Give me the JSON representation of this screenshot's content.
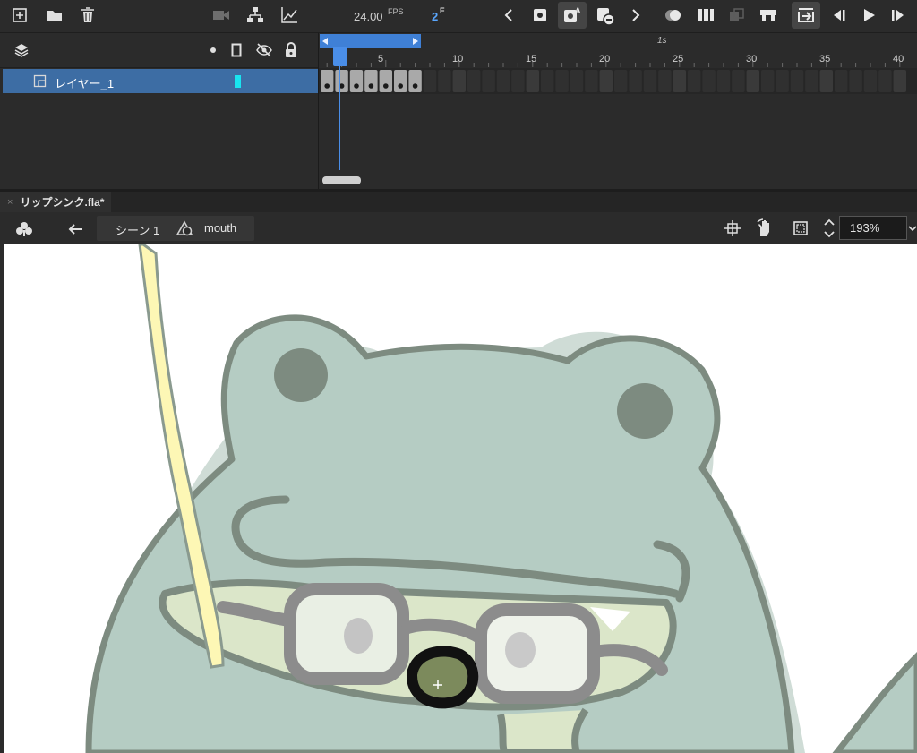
{
  "timeline": {
    "fps_value": "24.00",
    "fps_unit": "FPS",
    "current_frame": "2",
    "frame_unit": "F",
    "ruler_seconds_label": "1s",
    "tick_labels": [
      "5",
      "10",
      "15",
      "20",
      "25",
      "30",
      "35",
      "40"
    ],
    "keyframe_count": 7
  },
  "layers": [
    {
      "name": "レイヤー_1",
      "color": "#19e4f0",
      "selected": true
    }
  ],
  "document": {
    "tab_title": "リップシンク.fla*",
    "close_glyph": "×"
  },
  "editbar": {
    "scene": "シーン 1",
    "symbol": "mouth",
    "zoom": "193%"
  },
  "colors": {
    "accent": "#3f80d6",
    "layer_selected": "#3d6da4",
    "frog_body": "#b5ccc3",
    "frog_outline": "#7d8b80",
    "stage": "#ffffff"
  },
  "icons": {
    "toolbar_left": [
      "new-layer-icon",
      "new-folder-icon",
      "delete-icon"
    ],
    "toolbar_mid": [
      "camera-icon",
      "layer-parenting-icon",
      "graph-icon"
    ],
    "playback": [
      "prev-keyframe-icon",
      "insert-keyframe-icon",
      "auto-keyframe-icon",
      "clear-keyframe-icon",
      "next-keyframe-icon",
      "onion-skin-icon",
      "edit-multiple-frames-icon",
      "paste-frames-icon",
      "loop-range-icon",
      "loop-icon",
      "step-back-icon",
      "play-icon",
      "step-forward-icon"
    ],
    "layer_header": [
      "layers-icon",
      "highlight-dot-icon",
      "outline-icon",
      "visibility-icon",
      "lock-icon"
    ],
    "editbar": [
      "symbol-type-icon",
      "back-arrow-icon",
      "center-stage-icon",
      "rotate-hand-icon",
      "clip-content-icon",
      "zoom-stepper-icon",
      "zoom-dropdown-icon"
    ]
  }
}
